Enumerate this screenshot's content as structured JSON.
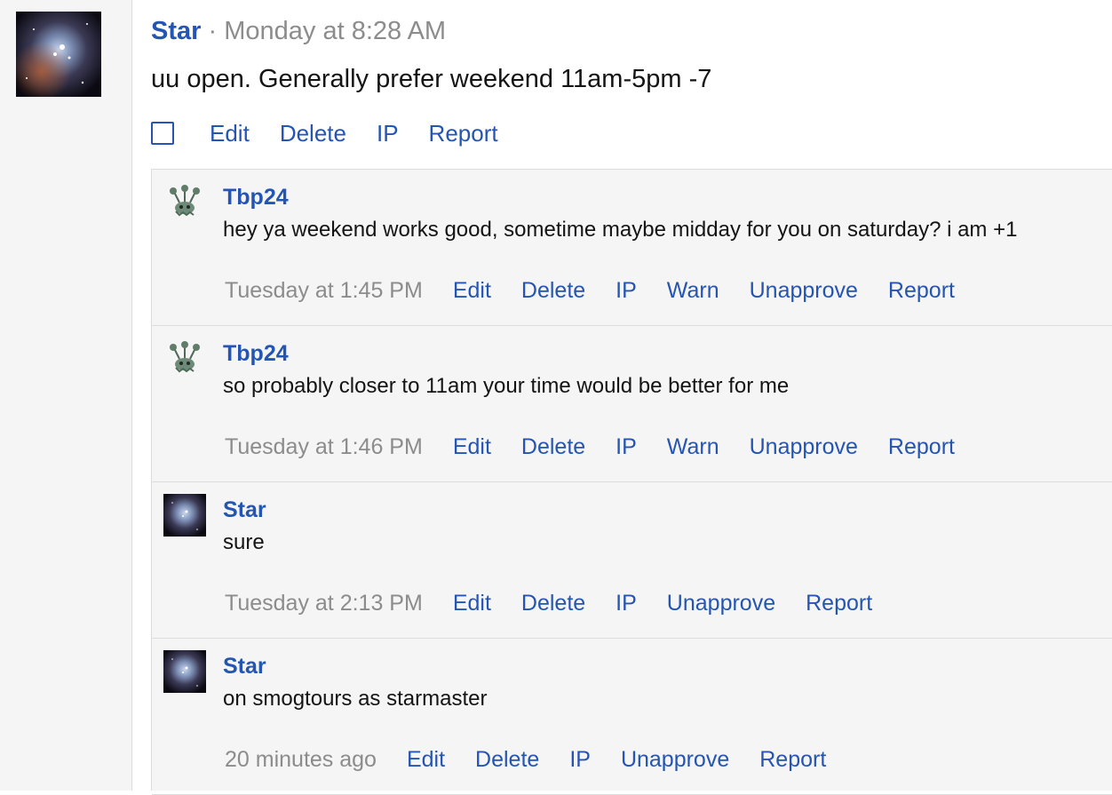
{
  "post": {
    "author": "Star",
    "separator": "·",
    "date": "Monday at 8:28 AM",
    "message": "uu open. Generally prefer weekend 11am-5pm -7",
    "actions": [
      "Edit",
      "Delete",
      "IP",
      "Report"
    ]
  },
  "comments": [
    {
      "author": "Tbp24",
      "avatar": "ghost-creature-avatar",
      "text": "hey ya weekend works good, sometime maybe midday for you on saturday? i am +1",
      "time": "Tuesday at 1:45 PM",
      "actions": [
        "Edit",
        "Delete",
        "IP",
        "Warn",
        "Unapprove",
        "Report"
      ]
    },
    {
      "author": "Tbp24",
      "avatar": "ghost-creature-avatar",
      "text": "so probably closer to 11am your time would be better for me",
      "time": "Tuesday at 1:46 PM",
      "actions": [
        "Edit",
        "Delete",
        "IP",
        "Warn",
        "Unapprove",
        "Report"
      ]
    },
    {
      "author": "Star",
      "avatar": "nebula-avatar",
      "text": "sure",
      "time": "Tuesday at 2:13 PM",
      "actions": [
        "Edit",
        "Delete",
        "IP",
        "Unapprove",
        "Report"
      ]
    },
    {
      "author": "Star",
      "avatar": "nebula-avatar",
      "text": "on smogtours as starmaster",
      "time": "20 minutes ago",
      "actions": [
        "Edit",
        "Delete",
        "IP",
        "Unapprove",
        "Report"
      ]
    }
  ],
  "colors": {
    "link": "#2455b3",
    "muted": "#8c8c8c",
    "text": "#141414",
    "panel": "#f5f5f5",
    "border": "#dcdcdc"
  }
}
